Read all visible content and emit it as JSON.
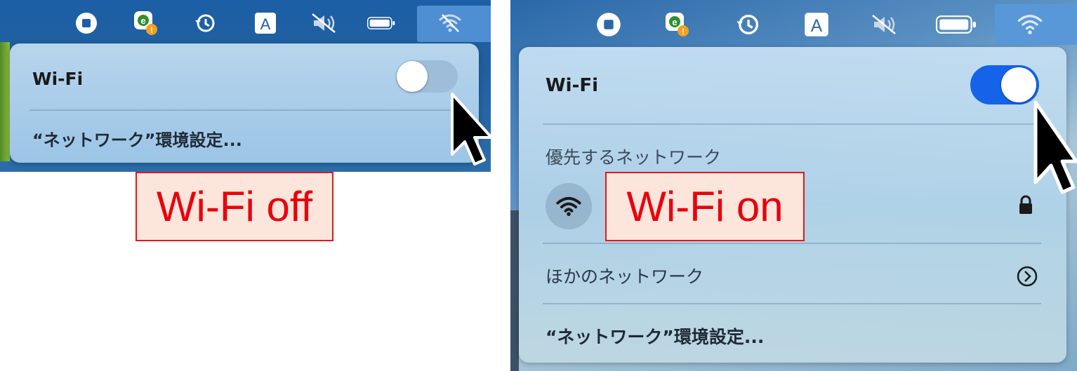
{
  "left": {
    "menu": {
      "title": "Wi-Fi",
      "wifi_enabled": false,
      "settings_item": "“ネットワーク”環境設定..."
    },
    "label": "Wi-Fi off"
  },
  "right": {
    "menu": {
      "title": "Wi-Fi",
      "wifi_enabled": true,
      "preferred_header": "優先するネットワーク",
      "other_networks": "ほかのネットワーク",
      "settings_item": "“ネットワーク”環境設定..."
    },
    "label": "Wi-Fi on"
  },
  "menubar_icons": [
    "stop-icon",
    "security-agent-icon",
    "time-machine-icon",
    "input-source-icon",
    "wifi-status-icon",
    "battery-icon",
    "wifi-icon"
  ],
  "colors": {
    "toggle_on": "#1463e8",
    "toggle_off": "#9dbdd8",
    "label_text": "#e8000d",
    "label_bg": "#fce6dc",
    "label_border": "#e0191f"
  }
}
